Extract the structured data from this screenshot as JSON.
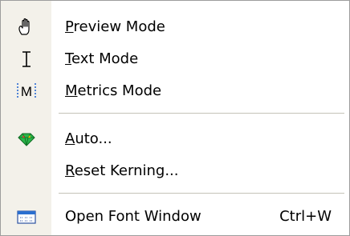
{
  "menu": {
    "items": [
      {
        "id": "preview-mode",
        "label_accel": "P",
        "label_rest": "review Mode",
        "icon": "hand-icon"
      },
      {
        "id": "text-mode",
        "label_accel": "T",
        "label_rest": "ext Mode",
        "icon": "text-cursor-icon"
      },
      {
        "id": "metrics-mode",
        "label_accel": "M",
        "label_rest": "etrics Mode",
        "icon": "metrics-icon",
        "icon_text": "M"
      },
      {
        "id": "auto",
        "label_accel": "A",
        "label_rest": "uto...",
        "icon": "gem-icon"
      },
      {
        "id": "reset-kerning",
        "label_accel": "R",
        "label_rest": "eset Kerning...",
        "icon": ""
      },
      {
        "id": "open-font-window",
        "label": "Open Font Window",
        "shortcut": "Ctrl+W",
        "icon": "font-window-icon"
      }
    ]
  }
}
